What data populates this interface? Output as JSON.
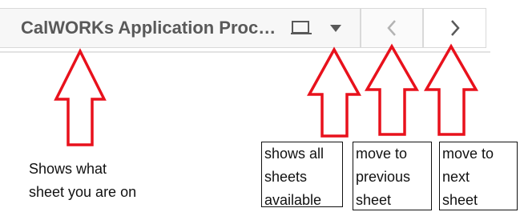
{
  "toolbar": {
    "sheet_title": "CalWORKs Application Proc…",
    "sheet_icon": "sheet-icon",
    "dropdown_icon": "caret-down-icon",
    "prev_icon": "chevron-left-icon",
    "next_icon": "chevron-right-icon"
  },
  "annotations": {
    "current_sheet": "Shows what\nsheet you are on",
    "all_sheets": "shows all\nsheets\navailable",
    "previous_sheet": "move to\nprevious\nsheet",
    "next_sheet": "move to\nnext\nsheet"
  },
  "colors": {
    "arrow": "#e8111c",
    "title_text": "#595959"
  }
}
